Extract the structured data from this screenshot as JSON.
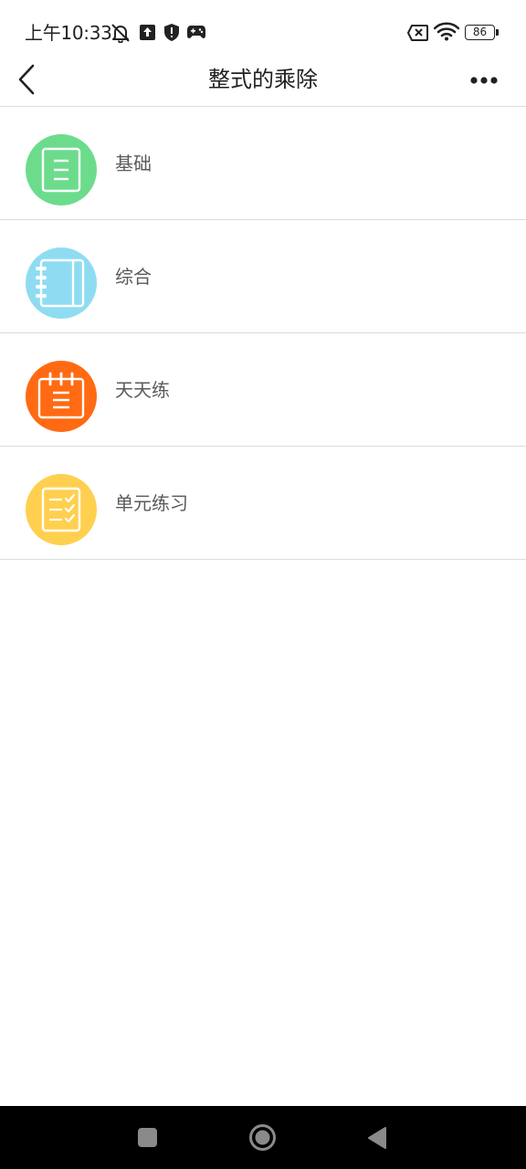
{
  "status_bar": {
    "time": "上午10:33",
    "battery": "86",
    "icons": [
      "bell-off-icon",
      "upload-icon",
      "shield-icon",
      "gamepad-icon",
      "sim-error-icon",
      "wifi-icon",
      "battery-icon"
    ]
  },
  "nav": {
    "title": "整式的乘除",
    "back_icon": "chevron-left-icon",
    "more_icon": "more-icon"
  },
  "items": [
    {
      "label": "基础",
      "icon": "document-icon",
      "color": "#6cdc8c"
    },
    {
      "label": "综合",
      "icon": "notebook-icon",
      "color": "#8fdcf2"
    },
    {
      "label": "天天练",
      "icon": "calendar-icon",
      "color": "#ff6a12"
    },
    {
      "label": "单元练习",
      "icon": "checklist-icon",
      "color": "#ffd04f"
    }
  ],
  "system_nav": {
    "buttons": [
      "recents-button",
      "home-button",
      "back-button"
    ]
  }
}
